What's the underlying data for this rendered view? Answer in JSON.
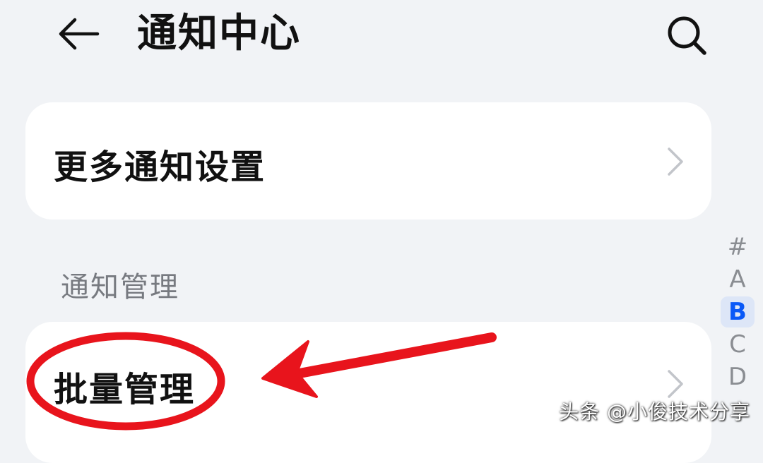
{
  "header": {
    "title": "通知中心",
    "back_icon": "back-arrow-icon",
    "search_icon": "search-icon"
  },
  "cards": {
    "more_settings": {
      "label": "更多通知设置",
      "icon": "chevron-right-icon"
    },
    "batch_manage": {
      "label": "批量管理",
      "icon": "chevron-right-icon"
    }
  },
  "section": {
    "notification_management": "通知管理"
  },
  "alpha_index": {
    "items": [
      "#",
      "A",
      "B",
      "C",
      "D"
    ],
    "active": "B"
  },
  "annotation": {
    "color": "#e8141c"
  },
  "watermark": {
    "text": "头条 @小俊技术分享"
  },
  "colors": {
    "background": "#f1f3f6",
    "card": "#ffffff",
    "accent": "#0a59f7"
  }
}
